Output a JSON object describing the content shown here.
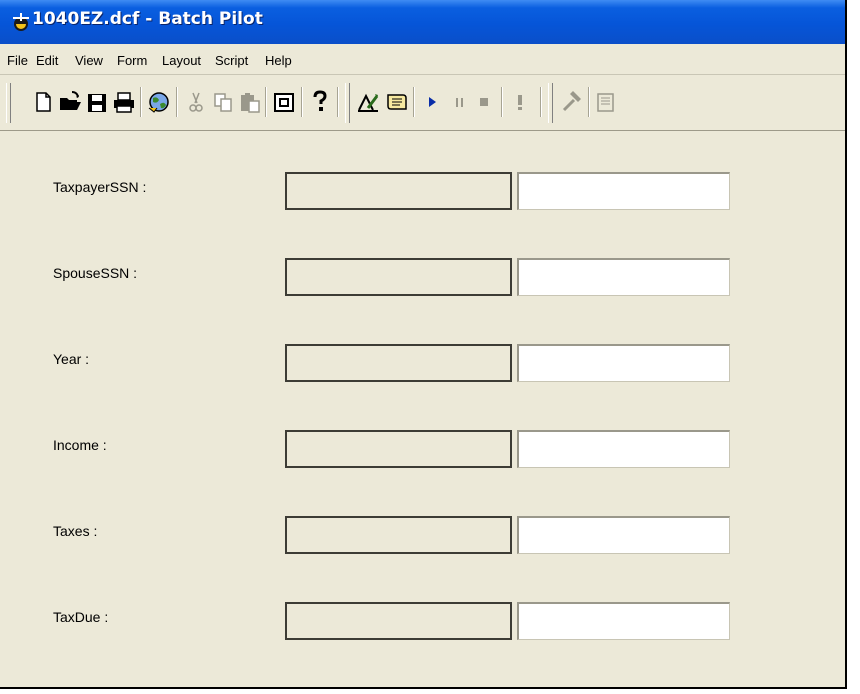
{
  "window": {
    "title": "1040EZ.dcf - Batch Pilot"
  },
  "menubar": {
    "items": [
      "File",
      "Edit",
      "View",
      "Form",
      "Layout",
      "Script",
      "Help"
    ]
  },
  "toolbar": {
    "buttons": [
      {
        "icon": "new-document-icon"
      },
      {
        "icon": "open-folder-icon"
      },
      {
        "icon": "save-disk-icon"
      },
      {
        "icon": "print-icon"
      },
      {
        "icon": "web-globe-icon"
      },
      {
        "icon": "cut-icon",
        "enabled": false
      },
      {
        "icon": "copy-icon",
        "enabled": false
      },
      {
        "icon": "paste-icon",
        "enabled": false
      },
      {
        "icon": "frame-icon"
      },
      {
        "icon": "help-icon"
      },
      {
        "icon": "design-tools-icon"
      },
      {
        "icon": "script-scroll-icon"
      },
      {
        "icon": "play-icon"
      },
      {
        "icon": "pause-icon",
        "enabled": false
      },
      {
        "icon": "stop-icon",
        "enabled": false
      },
      {
        "icon": "exclamation-icon",
        "enabled": false
      },
      {
        "icon": "hammer-icon",
        "enabled": false
      },
      {
        "icon": "properties-icon",
        "enabled": false
      }
    ]
  },
  "form": {
    "fields": [
      {
        "label": "TaxpayerSSN :",
        "value": ""
      },
      {
        "label": "SpouseSSN :",
        "value": ""
      },
      {
        "label": "Year :",
        "value": ""
      },
      {
        "label": "Income :",
        "value": ""
      },
      {
        "label": "Taxes :",
        "value": ""
      },
      {
        "label": "TaxDue :",
        "value": ""
      }
    ]
  },
  "colors": {
    "titlebar": "#0655d8",
    "face": "#ece9d8",
    "accent_play": "#0a2ea8"
  }
}
